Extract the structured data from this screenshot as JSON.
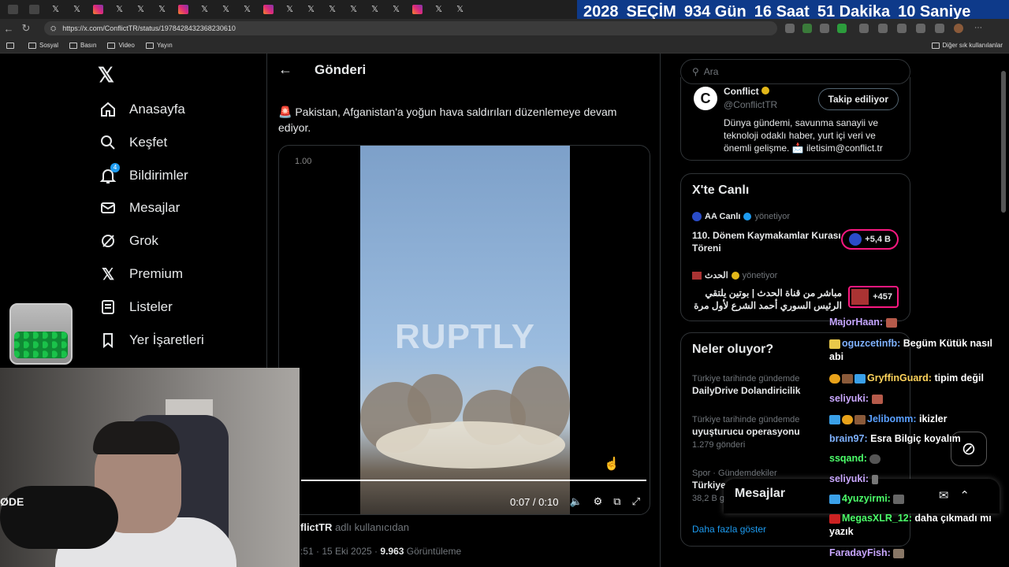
{
  "countdown": [
    "2028",
    "SEÇİM",
    "934 Gün",
    "16 Saat",
    "51 Dakika",
    "10 Saniye"
  ],
  "browser": {
    "url": "https://x.com/ConflictTR/status/1978428432368230610",
    "bookmarks": [
      "Sosyal",
      "Basın",
      "Video",
      "Yayın"
    ],
    "other_bookmarks": "Diğer sık kullanılanlar"
  },
  "nav": [
    {
      "label": "Anasayfa",
      "icon": "home-icon"
    },
    {
      "label": "Keşfet",
      "icon": "search-icon"
    },
    {
      "label": "Bildirimler",
      "icon": "bell-icon",
      "badge": "4"
    },
    {
      "label": "Mesajlar",
      "icon": "mail-icon"
    },
    {
      "label": "Grok",
      "icon": "grok-icon"
    },
    {
      "label": "Premium",
      "icon": "x-logo-icon"
    },
    {
      "label": "Listeler",
      "icon": "list-icon"
    },
    {
      "label": "Yer İşaretleri",
      "icon": "bookmark-icon"
    }
  ],
  "post": {
    "header": "Gönderi",
    "text": "Pakistan, Afganistan'a yoğun hava saldırıları düzenlemeye devam ediyor.",
    "video": {
      "speed": "1.00",
      "watermark": "RUPTLY",
      "time": "0:07 / 0:10",
      "progress": 0.7
    },
    "author_tail": "flictTR",
    "author_suffix": "adlı kullanıcıdan",
    "time_prefix": ":51 · 15 Eki 2025 · ",
    "views": "9.963",
    "views_label": "Görüntüleme"
  },
  "search": {
    "placeholder": "Ara"
  },
  "profile": {
    "name": "Conflict",
    "handle": "@ConflictTR",
    "follow_label": "Takip ediliyor",
    "bio": "Dünya gündemi, savunma sanayii ve teknoloji odaklı haber, yurt içi veri ve önemli gelişme. 📩 iletisim@conflict.tr"
  },
  "live": {
    "title": "X'te Canlı",
    "items": [
      {
        "source": "AA Canlı",
        "role": "yönetiyor",
        "title": "110. Dönem Kaymakamlar Kurası Töreni",
        "count": "+5,4 B"
      },
      {
        "source": "الحدث",
        "role": "yönetiyor",
        "title": "مباشر من قناة الحدث | بوتين يلتقي الرئيس السوري أحمد الشرع لأول مرة ...",
        "count": "+457"
      }
    ]
  },
  "trends": {
    "title": "Neler oluyor?",
    "items": [
      {
        "category": "Türkiye tarihinde gündemde",
        "name": "DailyDrive Dolandiricilik",
        "count": ""
      },
      {
        "category": "Türkiye tarihinde gündemde",
        "name": "uyuşturucu operasyonu",
        "count": "1.279 gönderi"
      },
      {
        "category": "Spor · Gündemdekiler",
        "name": "Türkiye - Gürcistan",
        "count": "38,2 B gönderi"
      }
    ],
    "show_more": "Daha fazla göster"
  },
  "messages": {
    "title": "Mesajlar"
  },
  "chat": [
    {
      "user": "MajorHaan:",
      "color": "#c4a5ff",
      "text": ""
    },
    {
      "user": "oguzcetinfb:",
      "color": "#7fb2ff",
      "text": "Begüm Kütük nasıl abi"
    },
    {
      "user": "GryffinGuard:",
      "color": "#ffd45c",
      "text": "tipim değil"
    },
    {
      "user": "seliyuki:",
      "color": "#c9a7ff",
      "text": ""
    },
    {
      "user": "Jelibomm:",
      "color": "#5aa0ff",
      "text": "ikizler"
    },
    {
      "user": "brain97:",
      "color": "#7fb2ff",
      "text": "Esra Bilgiç koyalım"
    },
    {
      "user": "ssqand:",
      "color": "#4cff6a",
      "text": ""
    },
    {
      "user": "seliyuki:",
      "color": "#c9a7ff",
      "text": ""
    },
    {
      "user": "4yuzyirmi:",
      "color": "#4cff6a",
      "text": ""
    },
    {
      "user": "MegasXLR_12:",
      "color": "#4cff6a",
      "text": "daha çıkmadı mı yazık"
    },
    {
      "user": "FaradayFish:",
      "color": "#c9a7ff",
      "text": ""
    }
  ],
  "webcam": {
    "logo": "ØDE"
  },
  "colors": {
    "accent": "#1d9bf0",
    "live": "#f91880",
    "countdown_bg": "#0e3a8a"
  }
}
